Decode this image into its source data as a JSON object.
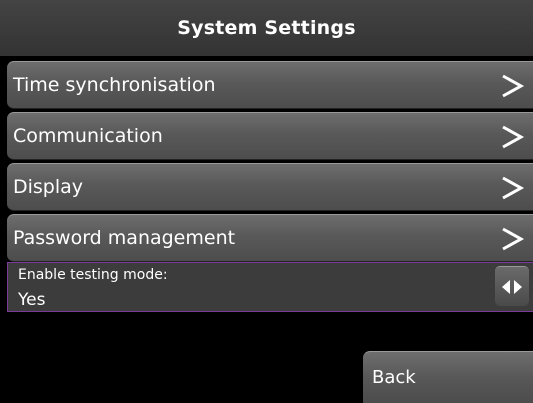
{
  "header": {
    "title": "System Settings"
  },
  "menu": {
    "items": [
      {
        "label": "Time synchronisation",
        "icon": "chevron-right-icon"
      },
      {
        "label": "Communication",
        "icon": "chevron-right-icon"
      },
      {
        "label": "Display",
        "icon": "chevron-right-icon"
      },
      {
        "label": "Password management",
        "icon": "chevron-right-icon"
      }
    ]
  },
  "testing_mode": {
    "label": "Enable testing mode:",
    "value": "Yes",
    "toggle_icon": "left-right-arrows-icon"
  },
  "footer": {
    "back_label": "Back"
  },
  "colors": {
    "background": "#000000",
    "header": "#3a3a3a",
    "button": "#5c5c5c",
    "highlight_border": "#7a3a9a",
    "text": "#ffffff"
  }
}
